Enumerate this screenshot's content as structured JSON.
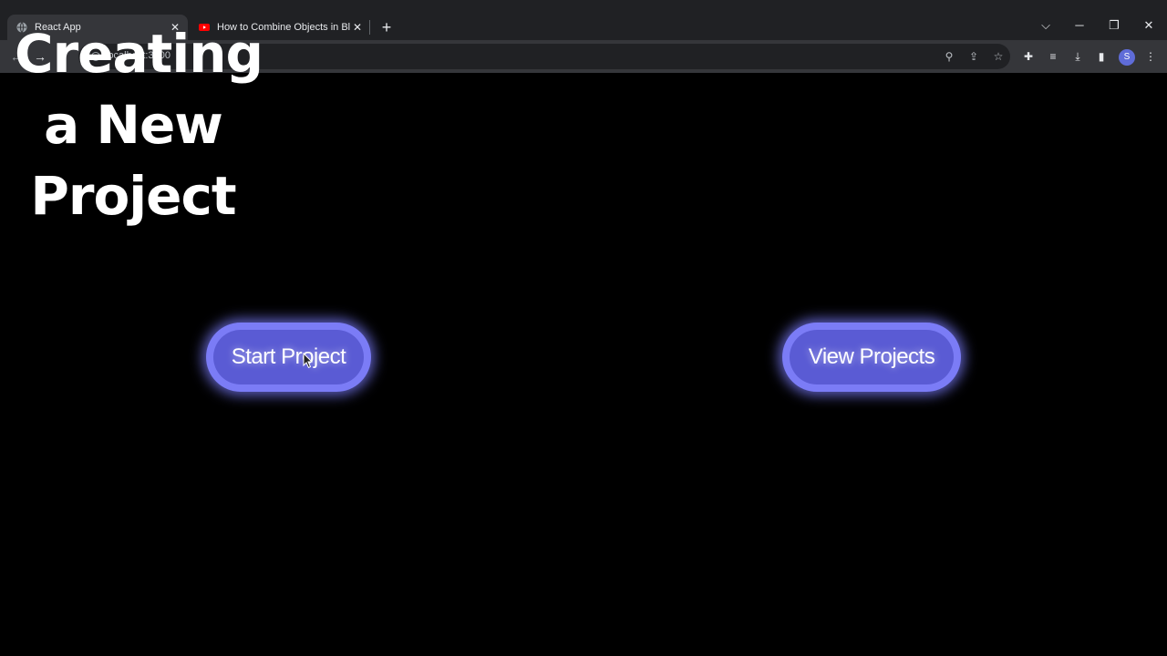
{
  "browser": {
    "tabs": [
      {
        "title": "React App",
        "active": true
      },
      {
        "title": "How to Combine Objects in Blen",
        "active": false
      }
    ],
    "new_tab_icon": "plus-icon",
    "url": "localhost:3000",
    "profile_initial": "S",
    "colors": {
      "tabstrip": "#202124",
      "toolbar": "#35363a",
      "youtube": "#ff0000"
    }
  },
  "page": {
    "heading_lines": [
      "Creating",
      "a New",
      "Project"
    ],
    "buttons": {
      "start_label": "Start Project",
      "view_label": "View Projects"
    },
    "colors": {
      "background": "#000000",
      "button_ring": "#7b7cf6",
      "button_fill": "#5a5bd4"
    }
  }
}
